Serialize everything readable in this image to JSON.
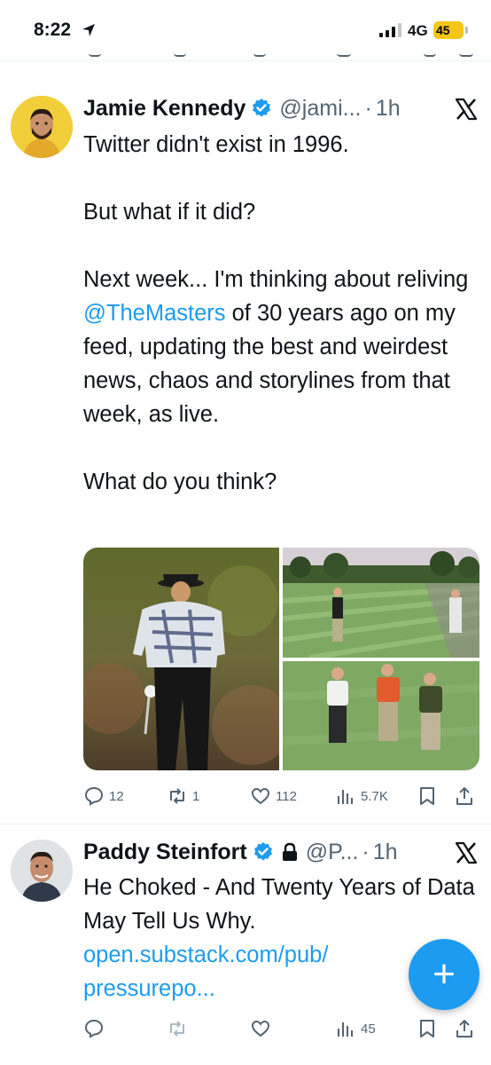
{
  "status_bar": {
    "time": "8:22",
    "network": "4G",
    "battery": "45"
  },
  "tweets": [
    {
      "name": "Jamie Kennedy",
      "handle": "@jami...",
      "time_ago": "1h",
      "text_before": "Twitter didn't exist in 1996.\n\nBut what if it did?\n\nNext week... I'm thinking about reliving ",
      "mention": "@TheMasters",
      "text_after": " of 30 years ago on my feed, updating the best and weirdest news, chaos and storylines from that week, as live.\n\nWhat do you think?",
      "actions": {
        "replies": "12",
        "reposts": "1",
        "likes": "112",
        "views": "5.7K"
      }
    },
    {
      "name": "Paddy Steinfort",
      "handle": "@P...",
      "time_ago": "1h",
      "text": "He Choked - And Twenty Years of Data May Tell Us Why.",
      "link": "open.substack.com/pub/\npressurepo...",
      "actions": {
        "views": "45"
      }
    }
  ],
  "icons": [
    "location-arrow-icon",
    "signal-icon",
    "verified-badge-icon",
    "lock-icon",
    "x-logo-icon",
    "reply-icon",
    "repost-icon",
    "like-icon",
    "views-icon",
    "bookmark-icon",
    "share-icon",
    "compose-icon"
  ],
  "colors": {
    "accent": "#1d9bf0",
    "muted": "#536471",
    "battery": "#f5c518",
    "verified": "#1d9bf0"
  }
}
